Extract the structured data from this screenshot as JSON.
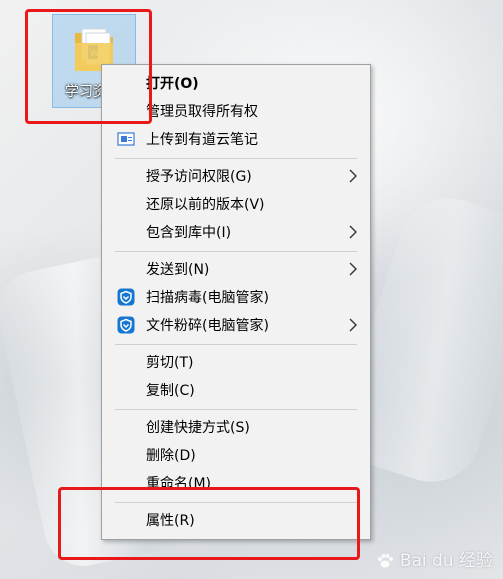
{
  "desktop": {
    "icon_label": "学习资"
  },
  "context_menu": {
    "items": [
      {
        "label": "打开(O)",
        "bold": true
      },
      {
        "label": "管理员取得所有权"
      },
      {
        "label": "上传到有道云笔记",
        "icon": "youdao-note-icon"
      },
      {
        "label": "授予访问权限(G)",
        "submenu": true
      },
      {
        "label": "还原以前的版本(V)"
      },
      {
        "label": "包含到库中(I)",
        "submenu": true
      },
      {
        "label": "发送到(N)",
        "submenu": true
      },
      {
        "label": "扫描病毒(电脑管家)",
        "icon": "tencent-pc-manager-icon"
      },
      {
        "label": "文件粉碎(电脑管家)",
        "icon": "tencent-pc-manager-icon",
        "submenu": true
      },
      {
        "label": "剪切(T)"
      },
      {
        "label": "复制(C)"
      },
      {
        "label": "创建快捷方式(S)"
      },
      {
        "label": "删除(D)"
      },
      {
        "label": "重命名(M)"
      },
      {
        "label": "属性(R)"
      }
    ]
  },
  "watermark": {
    "text": "Bai du 经验"
  },
  "colors": {
    "highlight": "#e8181b",
    "menu_background": "#f2f2f2",
    "selection": "#99c9ef",
    "pc_manager_blue": "#1677d2"
  }
}
